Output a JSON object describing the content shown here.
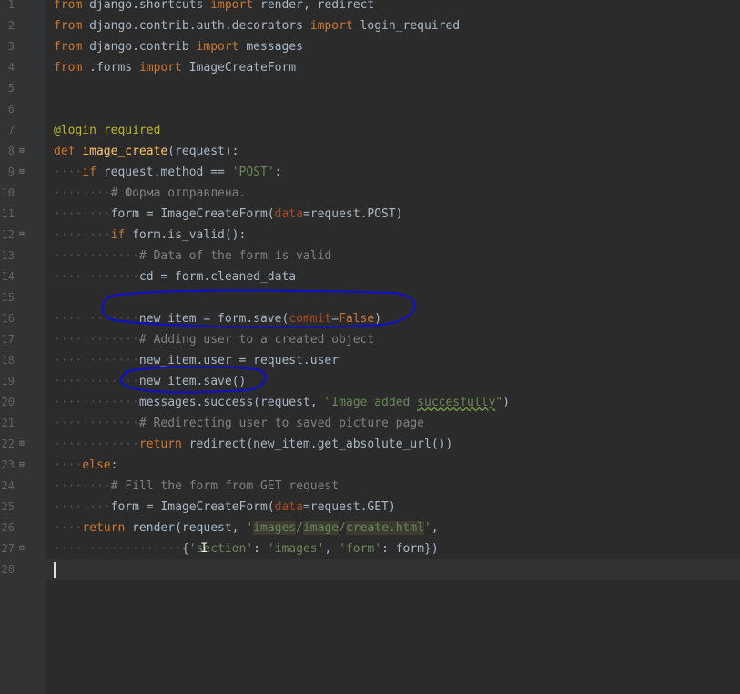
{
  "editor": {
    "language": "python",
    "current_line": 28,
    "lines": [
      {
        "n": 1,
        "ws": "",
        "code": [
          {
            "t": "kw",
            "v": "from"
          },
          {
            "t": "",
            "v": " django.shortcuts "
          },
          {
            "t": "kw",
            "v": "import"
          },
          {
            "t": "",
            "v": " render, redirect"
          }
        ]
      },
      {
        "n": 2,
        "ws": "",
        "code": [
          {
            "t": "kw",
            "v": "from"
          },
          {
            "t": "",
            "v": " django.contrib.auth.decorators "
          },
          {
            "t": "kw",
            "v": "import"
          },
          {
            "t": "",
            "v": " login_required"
          }
        ]
      },
      {
        "n": 3,
        "ws": "",
        "code": [
          {
            "t": "kw",
            "v": "from"
          },
          {
            "t": "",
            "v": " django.contrib "
          },
          {
            "t": "kw",
            "v": "import"
          },
          {
            "t": "",
            "v": " messages"
          }
        ]
      },
      {
        "n": 4,
        "ws": "",
        "code": [
          {
            "t": "kw",
            "v": "from"
          },
          {
            "t": "",
            "v": " .forms "
          },
          {
            "t": "kw",
            "v": "import"
          },
          {
            "t": "",
            "v": " ImageCreateForm"
          }
        ]
      },
      {
        "n": 5,
        "ws": "",
        "code": []
      },
      {
        "n": 6,
        "ws": "",
        "code": []
      },
      {
        "n": 7,
        "ws": "",
        "code": [
          {
            "t": "dec",
            "v": "@login_required"
          }
        ]
      },
      {
        "n": 8,
        "ws": "",
        "fold": "open",
        "code": [
          {
            "t": "kw",
            "v": "def"
          },
          {
            "t": "",
            "v": " "
          },
          {
            "t": "fn",
            "v": "image_create"
          },
          {
            "t": "",
            "v": "(request):"
          }
        ]
      },
      {
        "n": 9,
        "ws": "····",
        "fold": "open",
        "code": [
          {
            "t": "kw",
            "v": "if"
          },
          {
            "t": "",
            "v": " request.method == "
          },
          {
            "t": "str",
            "v": "'POST'"
          },
          {
            "t": "",
            "v": ":"
          }
        ]
      },
      {
        "n": 10,
        "ws": "········",
        "code": [
          {
            "t": "cm",
            "v": "# Форма отправлена."
          }
        ]
      },
      {
        "n": 11,
        "ws": "········",
        "code": [
          {
            "t": "",
            "v": "form = ImageCreateForm("
          },
          {
            "t": "kwarg",
            "v": "data"
          },
          {
            "t": "",
            "v": "=request.POST)"
          }
        ]
      },
      {
        "n": 12,
        "ws": "········",
        "fold": "open",
        "code": [
          {
            "t": "kw",
            "v": "if"
          },
          {
            "t": "",
            "v": " form.is_valid():"
          }
        ]
      },
      {
        "n": 13,
        "ws": "············",
        "code": [
          {
            "t": "cm",
            "v": "# Data of the form is valid"
          }
        ]
      },
      {
        "n": 14,
        "ws": "············",
        "code": [
          {
            "t": "",
            "v": "cd = form.cleaned_data"
          }
        ]
      },
      {
        "n": 15,
        "ws": "",
        "code": []
      },
      {
        "n": 16,
        "ws": "············",
        "code": [
          {
            "t": "",
            "v": "new_item = form.save("
          },
          {
            "t": "kwarg",
            "v": "commit"
          },
          {
            "t": "",
            "v": "="
          },
          {
            "t": "kw",
            "v": "False"
          },
          {
            "t": "",
            "v": ")"
          }
        ]
      },
      {
        "n": 17,
        "ws": "············",
        "code": [
          {
            "t": "cm",
            "v": "# Adding user to a created object"
          }
        ]
      },
      {
        "n": 18,
        "ws": "············",
        "code": [
          {
            "t": "",
            "v": "new_item.user = request.user"
          }
        ]
      },
      {
        "n": 19,
        "ws": "············",
        "code": [
          {
            "t": "",
            "v": "new_item.save()"
          }
        ]
      },
      {
        "n": 20,
        "ws": "············",
        "code": [
          {
            "t": "",
            "v": "messages.success(request, "
          },
          {
            "t": "str",
            "v": "\"Image added "
          },
          {
            "t": "str typo",
            "v": "succesfully"
          },
          {
            "t": "str",
            "v": "\""
          },
          {
            "t": "",
            "v": ")"
          }
        ]
      },
      {
        "n": 21,
        "ws": "············",
        "code": [
          {
            "t": "cm",
            "v": "# Redirecting user to saved picture page"
          }
        ]
      },
      {
        "n": 22,
        "ws": "············",
        "fold": "close",
        "code": [
          {
            "t": "kw",
            "v": "return"
          },
          {
            "t": "",
            "v": " redirect(new_item.get_absolute_url())"
          }
        ]
      },
      {
        "n": 23,
        "ws": "····",
        "fold": "open",
        "code": [
          {
            "t": "kw",
            "v": "else"
          },
          {
            "t": "",
            "v": ":"
          }
        ]
      },
      {
        "n": 24,
        "ws": "········",
        "code": [
          {
            "t": "cm",
            "v": "# Fill the form from GET request"
          }
        ]
      },
      {
        "n": 25,
        "ws": "········",
        "code": [
          {
            "t": "",
            "v": "form = ImageCreateForm("
          },
          {
            "t": "kwarg",
            "v": "data"
          },
          {
            "t": "",
            "v": "=request.GET)"
          }
        ]
      },
      {
        "n": 26,
        "ws": "····",
        "code": [
          {
            "t": "kw",
            "v": "return"
          },
          {
            "t": "",
            "v": " render(request, "
          },
          {
            "t": "str",
            "v": "'"
          },
          {
            "t": "str hl",
            "v": "images"
          },
          {
            "t": "str",
            "v": "/"
          },
          {
            "t": "str hl",
            "v": "image"
          },
          {
            "t": "str",
            "v": "/"
          },
          {
            "t": "str hl",
            "v": "create.html"
          },
          {
            "t": "str",
            "v": "'"
          },
          {
            "t": "",
            "v": ","
          }
        ]
      },
      {
        "n": 27,
        "ws": "··················",
        "fold": "close",
        "ibeam": true,
        "code": [
          {
            "t": "",
            "v": "{"
          },
          {
            "t": "str",
            "v": "'section'"
          },
          {
            "t": "",
            "v": ": "
          },
          {
            "t": "str",
            "v": "'images'"
          },
          {
            "t": "",
            "v": ", "
          },
          {
            "t": "str",
            "v": "'form'"
          },
          {
            "t": "",
            "v": ": form})"
          }
        ]
      },
      {
        "n": 28,
        "ws": "",
        "code": []
      }
    ]
  },
  "annotations": {
    "color": "#1010c8",
    "description": "hand-drawn ellipses around lines 16 and 19"
  }
}
